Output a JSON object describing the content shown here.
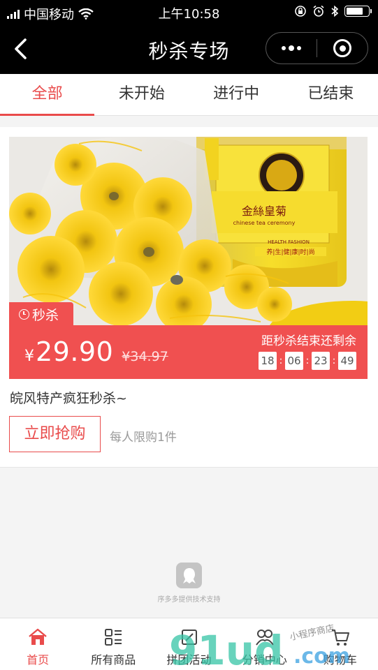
{
  "status_bar": {
    "carrier": "中国移动",
    "time": "上午10:58"
  },
  "nav": {
    "title": "秒杀专场",
    "back_icon": "chevron-left-icon",
    "more_icon": "more-dots-icon",
    "close_icon": "target-ring-icon"
  },
  "tabs": [
    {
      "label": "全部",
      "active": true
    },
    {
      "label": "未开始",
      "active": false
    },
    {
      "label": "进行中",
      "active": false
    },
    {
      "label": "已结束",
      "active": false
    }
  ],
  "product": {
    "flash_label": "秒杀",
    "currency": "¥",
    "price": "29.90",
    "original_price": "¥34.97",
    "countdown_label": "距秒杀结束还剩余",
    "countdown": {
      "hours": "18",
      "minutes": "06",
      "seconds": "23",
      "centis": "49"
    },
    "countdown_sep": ":",
    "title": "皖风特产疯狂秒杀~",
    "buy_label": "立即抢购",
    "limit": "每人限购1件",
    "jar_brand": "金絲皇菊",
    "jar_brand_en": "chinese tea ceremony",
    "jar_slogan_en": "HEALTH FASHION",
    "jar_slogan": "养|生|健|康|时|尚"
  },
  "footer": {
    "support_text": "序多多提供技术支持"
  },
  "tabbar": [
    {
      "label": "首页",
      "icon": "home-icon",
      "active": true
    },
    {
      "label": "所有商品",
      "icon": "grid-list-icon",
      "active": false
    },
    {
      "label": "拼团活动",
      "icon": "group-buy-icon",
      "active": false
    },
    {
      "label": "分销中心",
      "icon": "distribution-icon",
      "active": false
    },
    {
      "label": "购物车",
      "icon": "cart-icon",
      "active": false
    }
  ],
  "watermark": {
    "main": "91ud",
    "suffix": ".com",
    "tag": "小程序商店"
  },
  "colors": {
    "accent": "#e94b4b",
    "price_bar": "#f05050",
    "nav_bg": "#000000"
  }
}
